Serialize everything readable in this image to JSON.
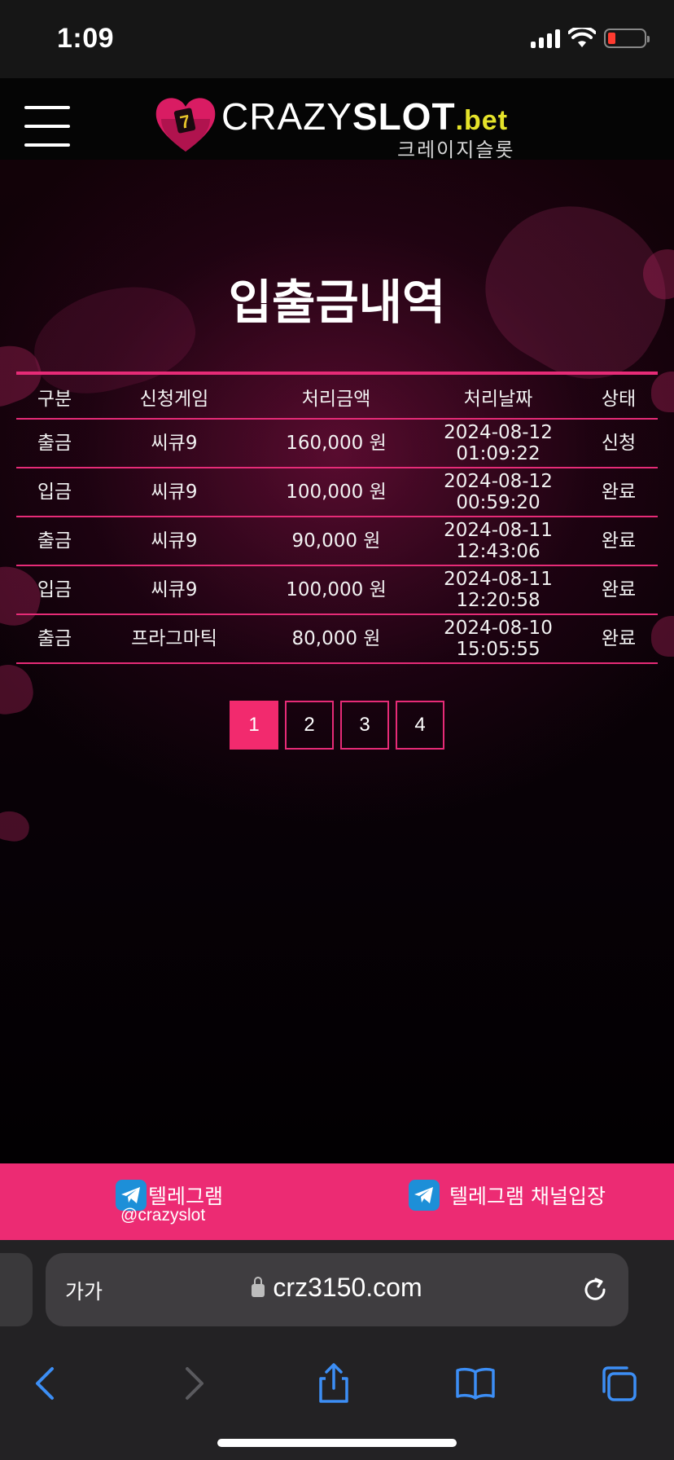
{
  "status_bar": {
    "time": "1:09"
  },
  "header": {
    "logo_crazy": "CRAZY",
    "logo_slot": "SLOT",
    "logo_bet": ".bet",
    "logo_sub": "크레이지슬롯"
  },
  "page_title": "입출금내역",
  "table": {
    "headers": [
      "구분",
      "신청게임",
      "처리금액",
      "처리날짜",
      "상태"
    ],
    "rows": [
      {
        "type": "출금",
        "game": "씨큐9",
        "amount": "160,000 원",
        "date": "2024-08-12",
        "time": "01:09:22",
        "status": "신청"
      },
      {
        "type": "입금",
        "game": "씨큐9",
        "amount": "100,000 원",
        "date": "2024-08-12",
        "time": "00:59:20",
        "status": "완료"
      },
      {
        "type": "출금",
        "game": "씨큐9",
        "amount": "90,000 원",
        "date": "2024-08-11",
        "time": "12:43:06",
        "status": "완료"
      },
      {
        "type": "입금",
        "game": "씨큐9",
        "amount": "100,000 원",
        "date": "2024-08-11",
        "time": "12:20:58",
        "status": "완료"
      },
      {
        "type": "출금",
        "game": "프라그마틱",
        "amount": "80,000 원",
        "date": "2024-08-10",
        "time": "15:05:55",
        "status": "완료"
      }
    ]
  },
  "pagination": {
    "pages": [
      "1",
      "2",
      "3",
      "4"
    ],
    "current": "1"
  },
  "telegram": {
    "left_label": "텔레그램",
    "left_handle": "@crazyslot",
    "right_label": "텔레그램 채널입장"
  },
  "browser": {
    "aa_label": "가가",
    "url": "crz3150.com"
  },
  "colors": {
    "accent": "#ec2b73",
    "table_line": "#e62b77",
    "logo_bet": "#e5e32a",
    "telegram": "#1d8fd8"
  }
}
